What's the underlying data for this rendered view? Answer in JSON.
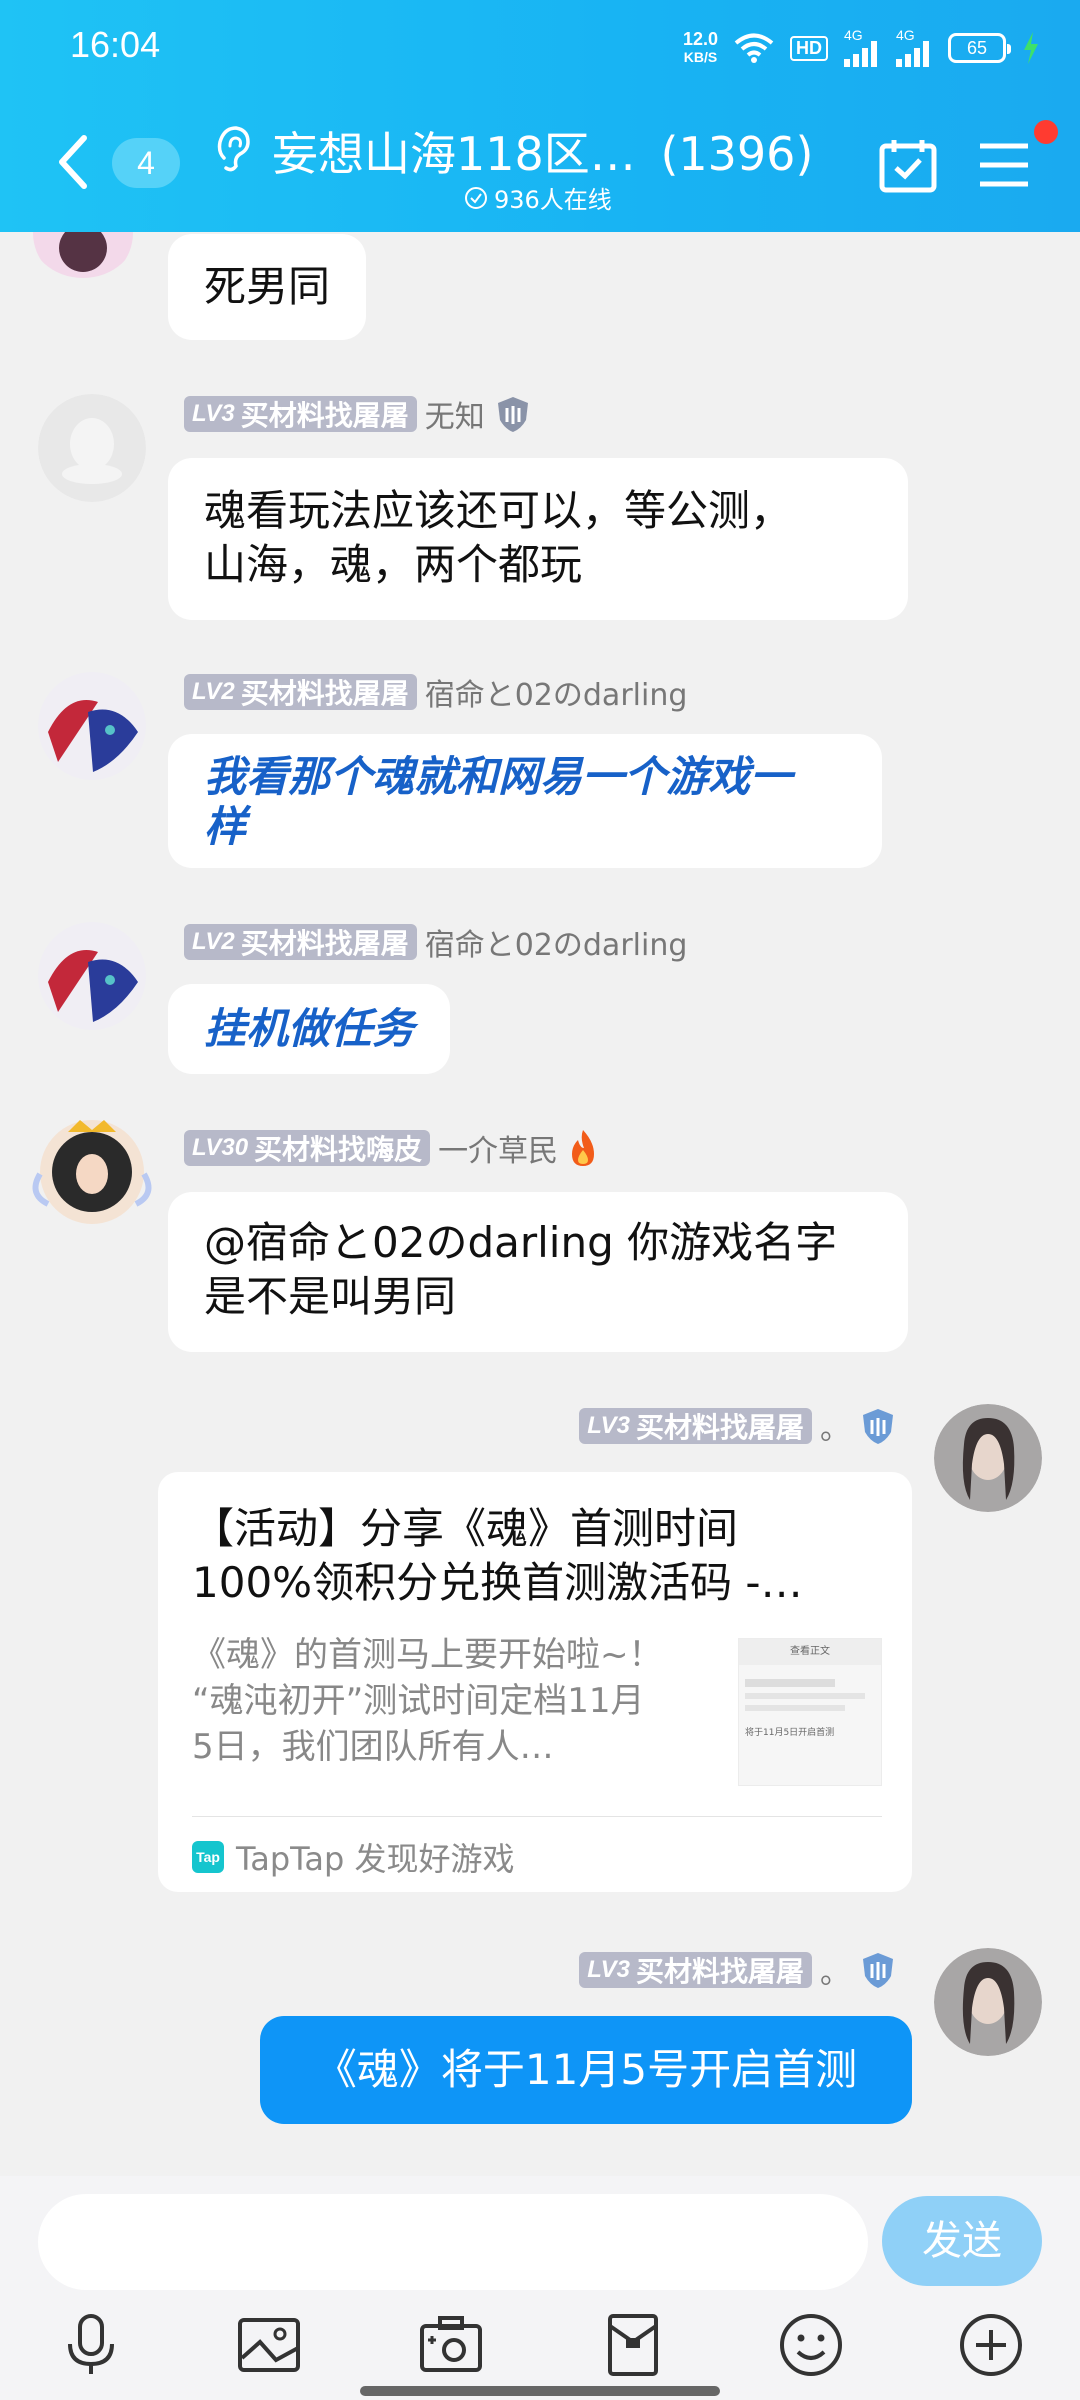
{
  "status": {
    "time": "16:04",
    "net_speed_value": "12.0",
    "net_speed_unit": "KB/S",
    "hd_label": "HD",
    "sig1_label": "4G",
    "sig2_label": "4G",
    "battery": "65"
  },
  "header": {
    "unread_count": "4",
    "title": "妄想山海118区…",
    "member_count": "(1396)",
    "online": "936人在线"
  },
  "messages": [
    {
      "text": "死男同"
    },
    {
      "badge_lv": "LV3",
      "badge_text": "买材料找屠屠",
      "name": "无知",
      "text_line1": "魂看玩法应该还可以，等公测，",
      "text_line2": "山海，魂，两个都玩"
    },
    {
      "badge_lv": "LV2",
      "badge_text": "买材料找屠屠",
      "name": "宿命と02のdarling",
      "text_line1": "我看那个魂就和网易一个游戏一",
      "text_line2": "样"
    },
    {
      "badge_lv": "LV2",
      "badge_text": "买材料找屠屠",
      "name": "宿命と02のdarling",
      "text": "挂机做任务"
    },
    {
      "badge_lv": "LV30",
      "badge_text": "买材料找嗨皮",
      "name": "一介草民",
      "text_line1": "@宿命と02のdarling 你游戏名字",
      "text_line2": "是不是叫男同"
    },
    {
      "badge_lv": "LV3",
      "badge_text": "买材料找屠屠",
      "name": "。",
      "card": {
        "title_line1": "【活动】分享《魂》首测时间",
        "title_line2": "100%领积分兑换首测激活码 -…",
        "desc_line1": "《魂》的首测马上要开始啦~！",
        "desc_line2": "“魂沌初开”测试时间定档11月",
        "desc_line3": "5日，我们团队所有人…",
        "thumb_header": "查看正文",
        "thumb_note": "将于11月5日开启首测",
        "source_logo": "Tap",
        "source": "TapTap 发现好游戏"
      }
    },
    {
      "badge_lv": "LV3",
      "badge_text": "买材料找屠屠",
      "name": "。",
      "text": "《魂》将于11月5号开启首测"
    }
  ],
  "composer": {
    "input_value": "",
    "send_label": "发送"
  },
  "toolbar_icons": [
    "mic-icon",
    "image-icon",
    "camera-icon",
    "red-packet-icon",
    "emoji-icon",
    "plus-icon"
  ]
}
